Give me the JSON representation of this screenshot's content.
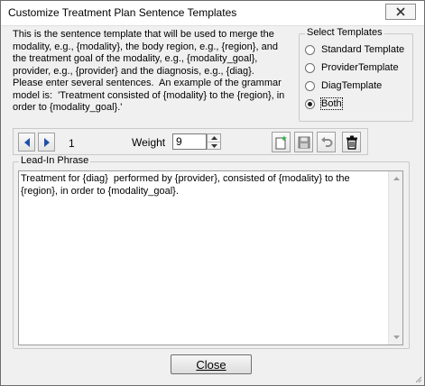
{
  "window": {
    "title": "Customize Treatment Plan Sentence Templates"
  },
  "description": "This is the sentence template that will be used to merge the\nmodality, e.g., {modality}, the body region, e.g., {region}, and\nthe treatment goal of the modality, e.g., {modality_goal},\nprovider, e.g., {provider} and the diagnosis, e.g., {diag}.\nPlease enter several sentences.  An example of the grammar\nmodel is:  'Treatment consisted of {modality} to the {region}, in\norder to {modality_goal}.'",
  "select_templates": {
    "legend": "Select Templates",
    "options": [
      {
        "label": "Standard Template",
        "selected": false
      },
      {
        "label": "ProviderTemplate",
        "selected": false
      },
      {
        "label": "DiagTemplate",
        "selected": false
      },
      {
        "label": "Both",
        "selected": true
      }
    ]
  },
  "toolbar": {
    "record_number": "1",
    "weight_label": "Weight",
    "weight_value": "9",
    "icons": [
      "prev-arrow-icon",
      "next-arrow-icon",
      "new-document-icon",
      "save-disk-icon",
      "undo-icon",
      "trash-icon"
    ]
  },
  "lead_in": {
    "legend": "Lead-In Phrase",
    "text": "Treatment for {diag}  performed by {provider}, consisted of {modality} to the\n{region}, in order to {modality_goal}."
  },
  "footer": {
    "close_label": "Close"
  },
  "colors": {
    "accent_blue": "#1f4fa8",
    "dialog_bg": "#f0f0f0"
  }
}
